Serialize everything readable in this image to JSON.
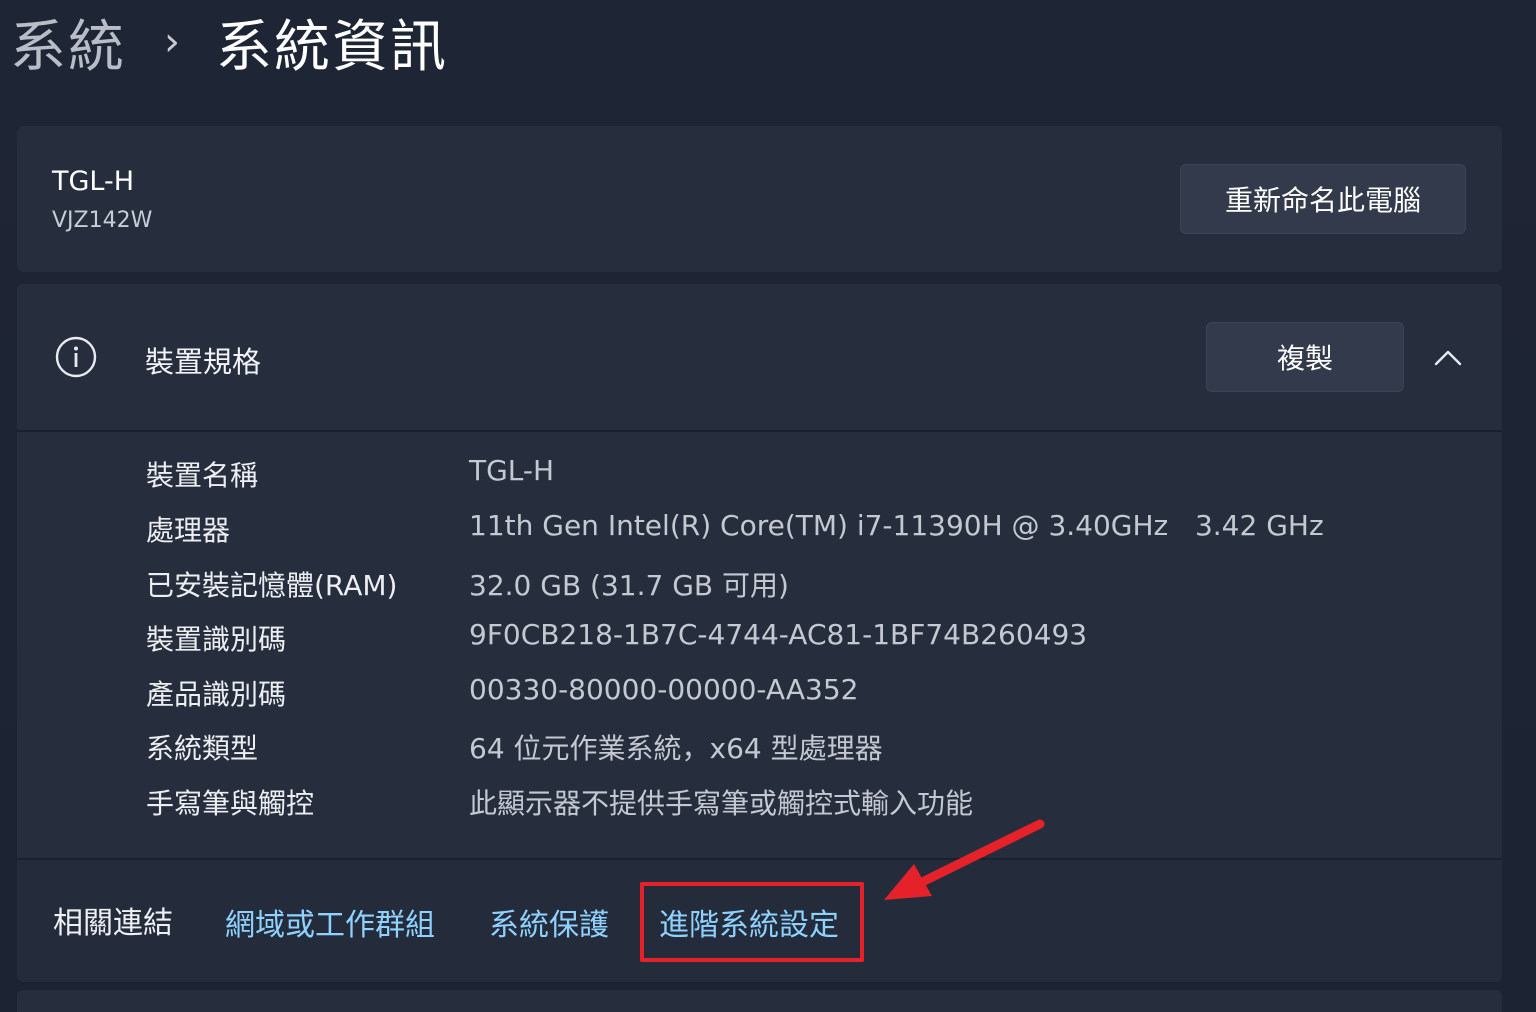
{
  "breadcrumb": {
    "parent": "系統",
    "separator": "›",
    "current": "系統資訊"
  },
  "device_card": {
    "name": "TGL-H",
    "model": "VJZ142W",
    "rename_button": "重新命名此電腦"
  },
  "specs": {
    "title": "裝置規格",
    "icon": "info-icon",
    "copy_button": "複製",
    "collapse_icon": "chevron-up-icon",
    "rows": [
      {
        "label": "裝置名稱",
        "value": "TGL-H"
      },
      {
        "label": "處理器",
        "value": "11th Gen Intel(R) Core(TM) i7-11390H @ 3.40GHz   3.42 GHz"
      },
      {
        "label": "已安裝記憶體(RAM)",
        "value": "32.0 GB (31.7 GB 可用)"
      },
      {
        "label": "裝置識別碼",
        "value": "9F0CB218-1B7C-4744-AC81-1BF74B260493"
      },
      {
        "label": "產品識別碼",
        "value": "00330-80000-00000-AA352"
      },
      {
        "label": "系統類型",
        "value": "64 位元作業系統，x64 型處理器"
      },
      {
        "label": "手寫筆與觸控",
        "value": "此顯示器不提供手寫筆或觸控式輸入功能"
      }
    ]
  },
  "related_links": {
    "label": "相關連結",
    "links": [
      {
        "label": "網域或工作群組"
      },
      {
        "label": "系統保護"
      },
      {
        "label": "進階系統設定"
      }
    ]
  },
  "colors": {
    "background": "#1c2332",
    "card": "#262e3e",
    "link": "#8fd2ff",
    "highlight": "#e5212a"
  }
}
